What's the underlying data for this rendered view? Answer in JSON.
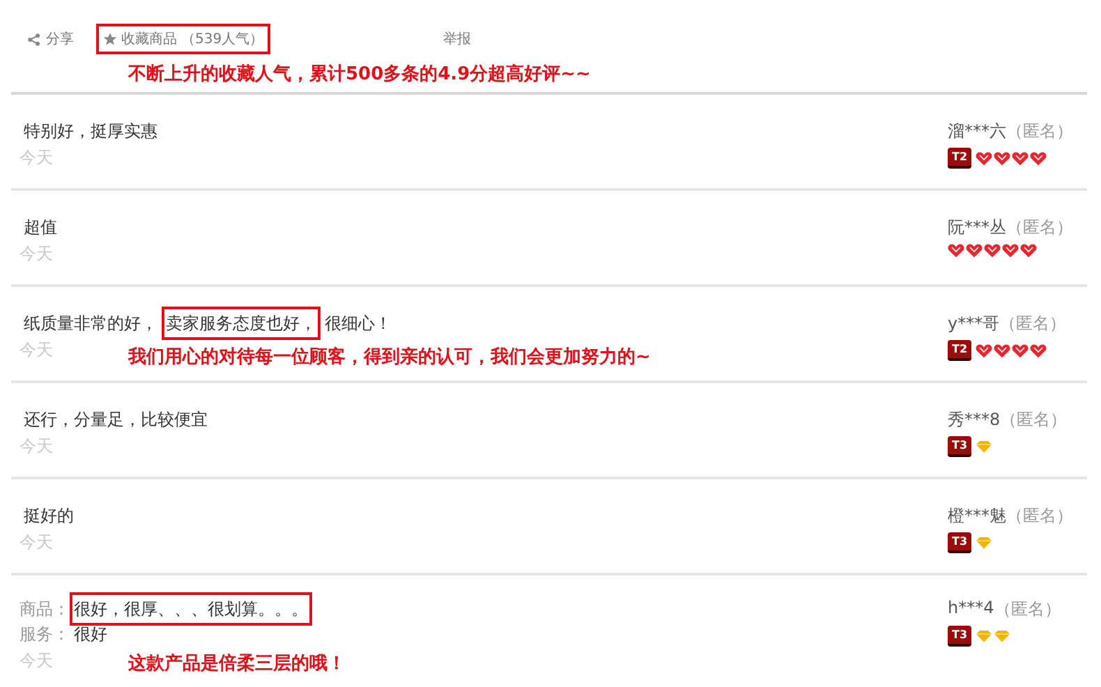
{
  "header": {
    "share": "分享",
    "collect": "收藏商品",
    "collect_count": "（539人气）",
    "collect_boxed": true,
    "report": "举报",
    "note": "不断上升的收藏人气，累计500多条的4.9分超高好评~~"
  },
  "reviews": [
    {
      "lines": [
        {
          "parts": [
            {
              "text": "特别好，挺厚实惠",
              "boxed": false
            }
          ]
        }
      ],
      "date": "今天",
      "user": "溜***六",
      "anon": "（匿名）",
      "badge": "T2",
      "credit": [
        {
          "kind": "heart"
        },
        {
          "kind": "heart"
        },
        {
          "kind": "heart"
        },
        {
          "kind": "heart"
        }
      ]
    },
    {
      "lines": [
        {
          "parts": [
            {
              "text": "超值",
              "boxed": false
            }
          ]
        }
      ],
      "date": "今天",
      "user": "阮***丛",
      "anon": "（匿名）",
      "credit": [
        {
          "kind": "heart"
        },
        {
          "kind": "heart"
        },
        {
          "kind": "heart"
        },
        {
          "kind": "heart"
        },
        {
          "kind": "heart"
        }
      ]
    },
    {
      "lines": [
        {
          "parts": [
            {
              "text": "纸质量非常的好，",
              "boxed": false
            },
            {
              "text": "卖家服务态度也好，",
              "boxed": true
            },
            {
              "text": "很细心！",
              "boxed": false
            }
          ]
        }
      ],
      "date": "今天",
      "user": "y***哥",
      "anon": "（匿名）",
      "badge": "T2",
      "credit": [
        {
          "kind": "heart"
        },
        {
          "kind": "heart"
        },
        {
          "kind": "heart"
        },
        {
          "kind": "heart"
        }
      ],
      "note": "我们用心的对待每一位顾客，得到亲的认可，我们会更加努力的~"
    },
    {
      "lines": [
        {
          "parts": [
            {
              "text": "还行，分量足，比较便宜",
              "boxed": false
            }
          ]
        }
      ],
      "date": "今天",
      "user": "秀***8",
      "anon": "（匿名）",
      "badge": "T3",
      "credit": [
        {
          "kind": "diamond"
        }
      ]
    },
    {
      "lines": [
        {
          "parts": [
            {
              "text": "挺好的",
              "boxed": false
            }
          ]
        }
      ],
      "date": "今天",
      "user": "橙***魅",
      "anon": "（匿名）",
      "badge": "T3",
      "credit": [
        {
          "kind": "diamond"
        }
      ]
    },
    {
      "lines": [
        {
          "label": "商品：",
          "parts": [
            {
              "text": "很好，很厚、、、很划算。。。",
              "boxed": true
            }
          ]
        },
        {
          "label": "服务：",
          "parts": [
            {
              "text": "很好",
              "boxed": false
            }
          ]
        }
      ],
      "date": "今天",
      "user": "h***4",
      "anon": "（匿名）",
      "badge": "T3",
      "credit": [
        {
          "kind": "diamond"
        },
        {
          "kind": "diamond"
        }
      ],
      "note": "这款产品是倍柔三层的哦！"
    }
  ]
}
